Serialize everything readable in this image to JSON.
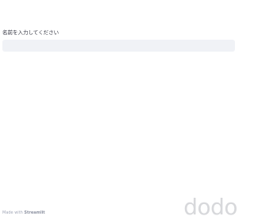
{
  "form": {
    "name_label": "名前を入力してください",
    "name_value": "",
    "name_placeholder": ""
  },
  "footer": {
    "prefix": "Made with ",
    "brand": "Streamlit"
  },
  "watermark": {
    "text": "dodo"
  },
  "colors": {
    "input_background": "#f0f2f6",
    "label_text": "#31333f",
    "footer_text": "#a3a8b8",
    "watermark": "#d7d8db"
  }
}
